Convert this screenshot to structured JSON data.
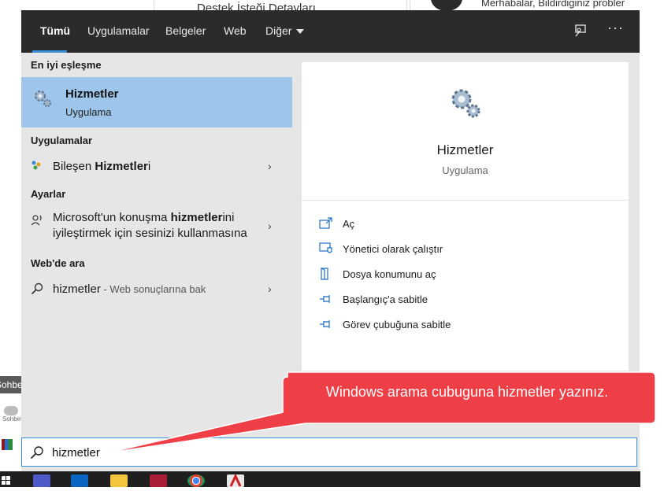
{
  "background": {
    "doc_title": "Destek İsteği Detayları",
    "chat_preview": "Merhabalar, Bildirdiğiniz probler",
    "left_tooltip": "Sohbet",
    "left_chat_label": "Sohbet"
  },
  "tabs": [
    {
      "label": "Tümü",
      "active": true
    },
    {
      "label": "Uygulamalar"
    },
    {
      "label": "Belgeler"
    },
    {
      "label": "Web"
    },
    {
      "label": "Diğer"
    }
  ],
  "topbar_icons": [
    "feedback-icon",
    "more-options-icon"
  ],
  "more_glyph": "···",
  "left": {
    "best_match_header": "En iyi eşleşme",
    "best_match": {
      "title": "Hizmetler",
      "subtitle": "Uygulama"
    },
    "apps_header": "Uygulamalar",
    "app_item": {
      "prefix": "Bileşen ",
      "bold": "Hizmetler",
      "suffix": "i"
    },
    "settings_header": "Ayarlar",
    "settings_item": {
      "line1_pre": "Microsoft'un konuşma ",
      "line1_bold": "hizmetler",
      "line1_post": "ini",
      "line2": "iyileştirmek için sesinizi kullanmasına"
    },
    "web_header": "Web'de ara",
    "web_item": {
      "query": "hizmetler",
      "suffix": " - Web sonuçlarına bak"
    }
  },
  "right": {
    "title": "Hizmetler",
    "subtitle": "Uygulama",
    "actions": [
      {
        "label": "Aç",
        "icon": "open-icon"
      },
      {
        "label": "Yönetici olarak çalıştır",
        "icon": "admin-shield-icon"
      },
      {
        "label": "Dosya konumunu aç",
        "icon": "file-location-icon"
      },
      {
        "label": "Başlangıç'a sabitle",
        "icon": "pin-start-icon"
      },
      {
        "label": "Görev çubuğuna sabitle",
        "icon": "pin-taskbar-icon"
      }
    ]
  },
  "search": {
    "value": "hizmetler"
  },
  "callout": {
    "text": "Windows arama cubuguna hizmetler yazınız.",
    "color": "#f0434a"
  },
  "accent_color": "#3a8fd8",
  "selected_bg": "#9dc6ea",
  "chevron": "›"
}
